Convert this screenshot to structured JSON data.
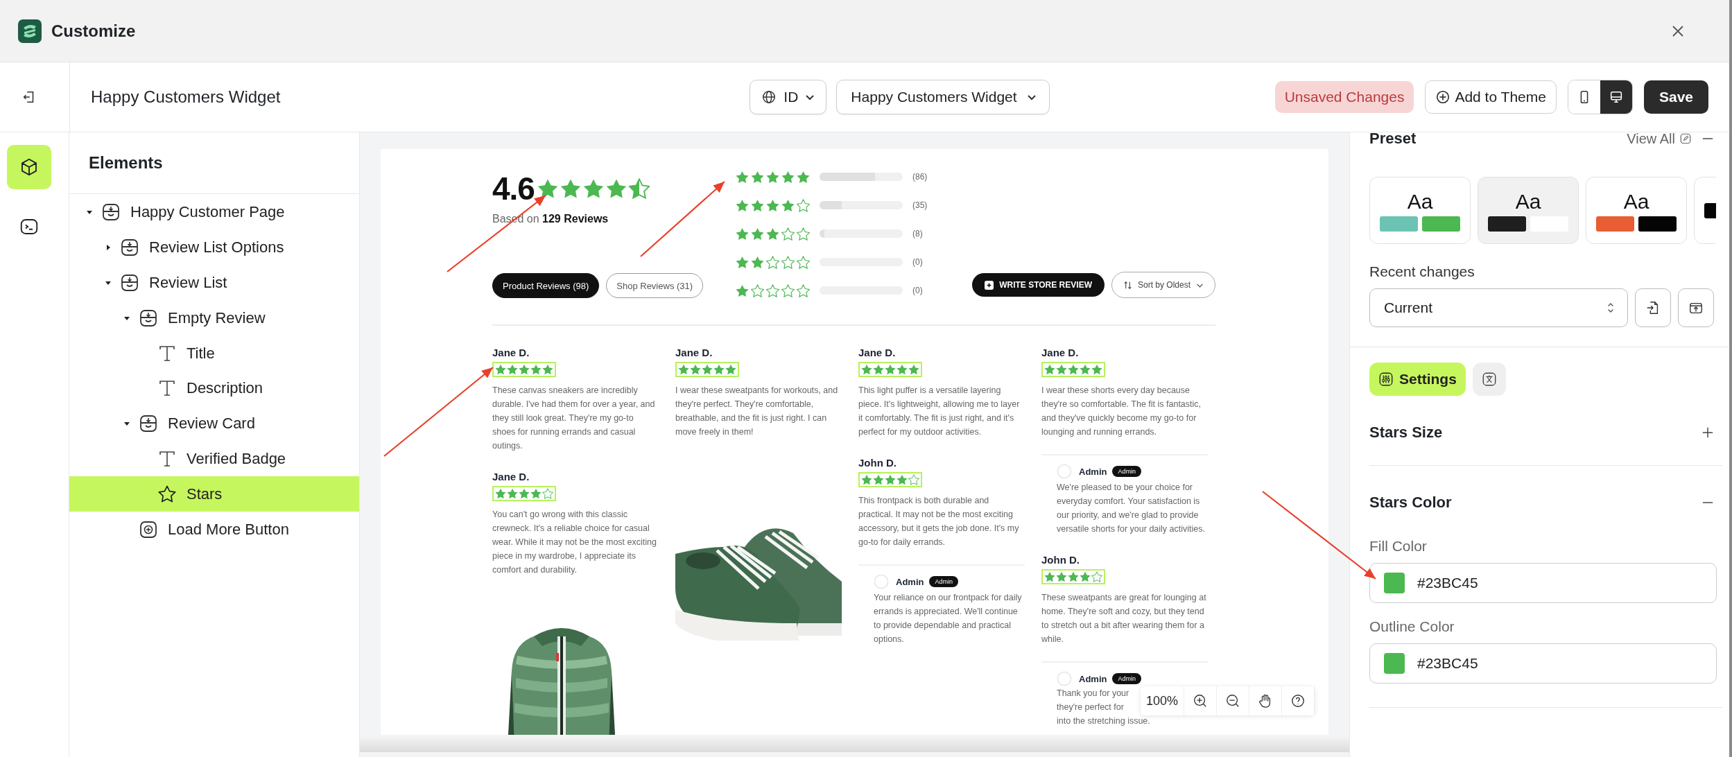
{
  "window": {
    "title": "Customize"
  },
  "header": {
    "title": "Happy Customers Widget",
    "language": "ID",
    "widget": "Happy Customers Widget",
    "status": "Unsaved Changes",
    "add_button": "Add to Theme",
    "save_button": "Save",
    "devices": [
      {
        "kind": "mobile",
        "selected": false
      },
      {
        "kind": "desktop",
        "selected": true
      }
    ]
  },
  "rail": [
    {
      "kind": "elements",
      "selected": true
    },
    {
      "kind": "code",
      "selected": false
    }
  ],
  "elements": {
    "title": "Elements",
    "tree": [
      {
        "label": "Happy Customer Page",
        "kind": "section",
        "expanded": true,
        "selected": false,
        "children": [
          {
            "label": "Review List Options",
            "kind": "section",
            "expanded": false,
            "selected": false
          },
          {
            "label": "Review List",
            "kind": "section",
            "expanded": true,
            "selected": false,
            "children": [
              {
                "label": "Empty Review",
                "kind": "section",
                "expanded": true,
                "selected": false,
                "children": [
                  {
                    "label": "Title",
                    "kind": "text",
                    "selected": false
                  },
                  {
                    "label": "Description",
                    "kind": "text",
                    "selected": false
                  }
                ]
              },
              {
                "label": "Review Card",
                "kind": "section",
                "expanded": true,
                "selected": false,
                "children": [
                  {
                    "label": "Verified Badge",
                    "kind": "text",
                    "selected": false
                  },
                  {
                    "label": "Stars",
                    "kind": "star",
                    "selected": true
                  }
                ]
              },
              {
                "label": "Load More Button",
                "kind": "button",
                "selected": false
              }
            ]
          }
        ]
      }
    ]
  },
  "preview": {
    "summary": {
      "rating": "4.6",
      "stars": 4.5,
      "based_on": "Based on **129 Reviews**",
      "breakdown": [
        {
          "stars": 5,
          "level": 0.67,
          "count": "(86)"
        },
        {
          "stars": 4,
          "level": 0.27,
          "count": "(35)"
        },
        {
          "stars": 3,
          "level": 0.06,
          "count": "(8)"
        },
        {
          "stars": 2,
          "count": "(0)"
        },
        {
          "stars": 1,
          "count": "(0)"
        }
      ],
      "tabs": [
        {
          "label": "Product Reviews (98)",
          "selected": true
        },
        {
          "label": "Shop Reviews (31)",
          "selected": false
        }
      ],
      "write_button": "WRITE STORE REVIEW",
      "sort": "Sort by Oldest"
    },
    "columns": [
      [
        {
          "kind": "review",
          "name": "Jane D.",
          "stars": 5,
          "text": "These canvas sneakers are incredibly durable. I've had them for over a year, and they still look great. They're my go-to shoes for running errands and casual outings."
        },
        {
          "kind": "review",
          "name": "Jane D.",
          "stars": 4,
          "text": "You can't go wrong with this classic crewneck. It's a reliable choice for casual wear. While it may not be the most exciting piece in my wardrobe, I appreciate its comfort and durability."
        },
        {
          "kind": "picture"
        }
      ],
      [
        {
          "kind": "review",
          "name": "Jane D.",
          "stars": 5,
          "text": "I wear these sweatpants for workouts, and they're perfect. They're comfortable, breathable, and the fit is just right. I can move freely in them!"
        },
        {
          "kind": "picture"
        }
      ],
      [
        {
          "kind": "review",
          "name": "Jane D.",
          "stars": 5,
          "text": "This light puffer is a versatile layering piece. It's lightweight, allowing me to layer it comfortably. The fit is just right, and it's perfect for my outdoor activities."
        },
        {
          "kind": "review",
          "name": "John D.",
          "stars": 4,
          "text": "This frontpack is both durable and practical. It may not be the most exciting accessory, but it gets the job done. It's my go-to for daily errands."
        },
        {
          "kind": "reply",
          "author": "Admin",
          "badge": "Admin",
          "text": "Your reliance on our frontpack for daily errands is appreciated. We'll continue to provide dependable and practical options."
        }
      ],
      [
        {
          "kind": "review",
          "name": "Jane D.",
          "stars": 5,
          "text": "I wear these shorts every day because they're so comfortable. The fit is fantastic, and they've quickly become my go-to for lounging and running errands."
        },
        {
          "kind": "reply",
          "author": "Admin",
          "badge": "Admin",
          "text": "We're pleased to be your choice for everyday comfort. Your satisfaction is our priority, and we're glad to provide versatile shorts for your daily activities."
        },
        {
          "kind": "review",
          "name": "John D.",
          "stars": 4,
          "text": "These sweatpants are great for lounging at home. They're soft and cozy, but they tend to stretch out a bit after wearing them for a while."
        },
        {
          "kind": "reply",
          "author": "Admin",
          "badge": "Admin",
          "lines": [
            "Thank you for your",
            "they're perfect for",
            "into the stretching issue."
          ]
        }
      ]
    ],
    "zoom": "100%"
  },
  "panel": {
    "preset": {
      "title": "Preset",
      "link": "View All",
      "cards": [
        {
          "label": "Aa",
          "selected": false,
          "swatches": [
            {
              "color": "#6cc3b3"
            },
            {
              "color": "#4cb851"
            }
          ]
        },
        {
          "label": "Aa",
          "selected": true,
          "swatches": [
            {
              "color": "#1f1f1f"
            },
            {
              "color": "#ffffff"
            }
          ]
        },
        {
          "label": "Aa",
          "selected": false,
          "swatches": [
            {
              "color": "#e85d33"
            },
            {
              "color": "#050505"
            }
          ]
        },
        {
          "selected": false,
          "swatches": [
            {
              "color": "#050505"
            }
          ]
        }
      ]
    },
    "recent": {
      "label": "Recent changes",
      "value": "Current"
    },
    "tabs": [
      {
        "kind": "settings",
        "label": "Settings",
        "selected": true
      },
      {
        "kind": "translate",
        "selected": false
      }
    ],
    "sections": [
      {
        "title": "Stars Size",
        "expanded": false
      },
      {
        "title": "Stars Color",
        "expanded": true,
        "fields": [
          {
            "label": "Fill Color",
            "value": "#23BC45",
            "color": "#4cb851"
          },
          {
            "label": "Outline Color",
            "value": "#23BC45",
            "color": "#4cb851"
          }
        ]
      }
    ]
  }
}
